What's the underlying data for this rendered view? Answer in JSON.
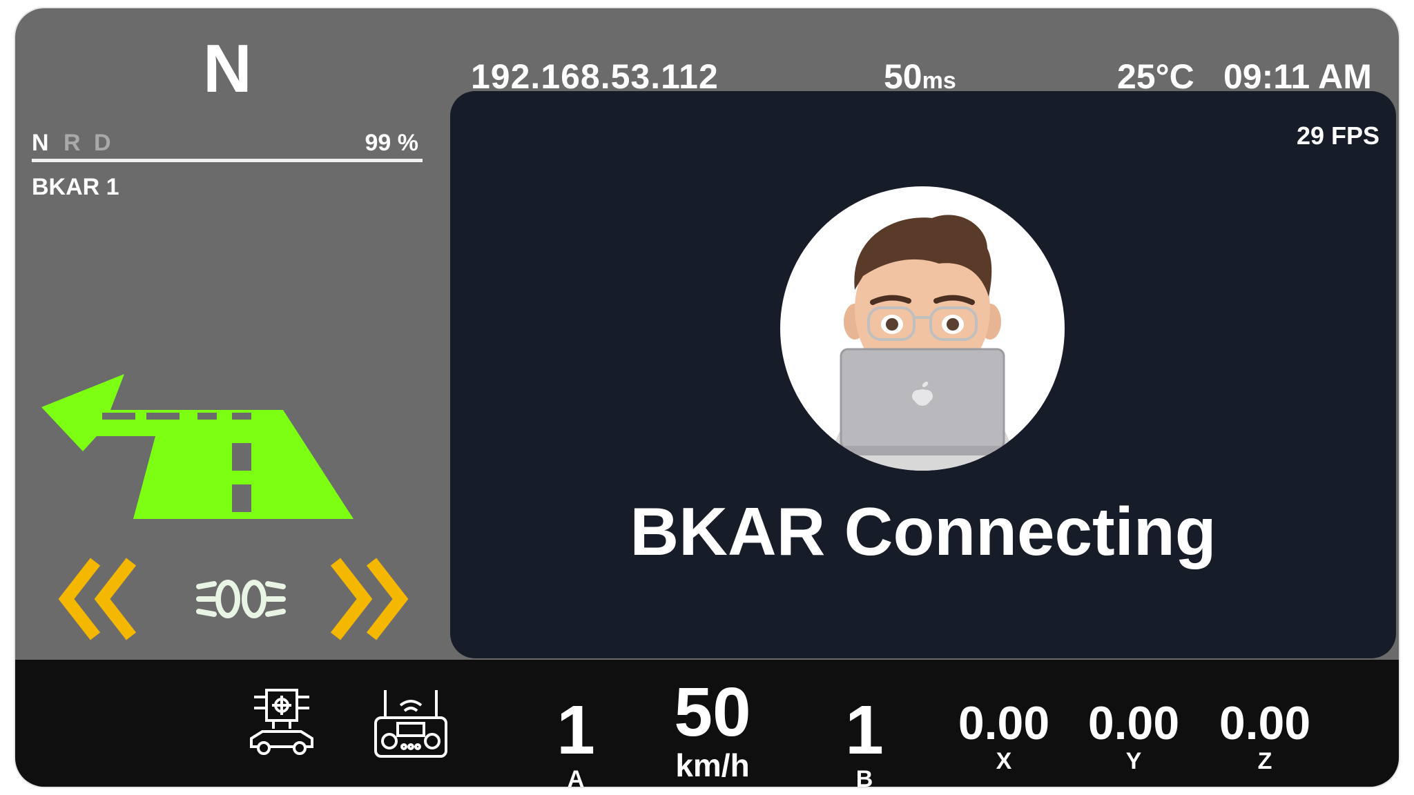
{
  "header": {
    "gear": "N",
    "ip": "192.168.53.112",
    "latency_value": "50",
    "latency_unit": "ms",
    "temperature": "25°C",
    "time": "09:11 AM"
  },
  "left_panel": {
    "gear_selector": [
      "N",
      "R",
      "D"
    ],
    "active_gear": "N",
    "battery": "99 %",
    "vehicle_name": "BKAR 1",
    "road_icon": "turn-left-road-icon",
    "road_color": "#7cff12",
    "left_signal_icon": "left-turn-signal-icon",
    "headlight_icon": "headlight-icon",
    "right_signal_icon": "right-turn-signal-icon",
    "signal_color": "#f5b800"
  },
  "video": {
    "fps": "29 FPS",
    "status": "BKAR Connecting",
    "avatar_icon": "user-avatar-icon"
  },
  "bottom_bar": {
    "icons": [
      "autonomous-car-icon",
      "remote-controller-icon"
    ],
    "a_value": "1",
    "a_label": "A",
    "speed_value": "50",
    "speed_unit": "km/h",
    "b_value": "1",
    "b_label": "B",
    "x_value": "0.00",
    "x_label": "X",
    "y_value": "0.00",
    "y_label": "Y",
    "z_value": "0.00",
    "z_label": "Z"
  }
}
